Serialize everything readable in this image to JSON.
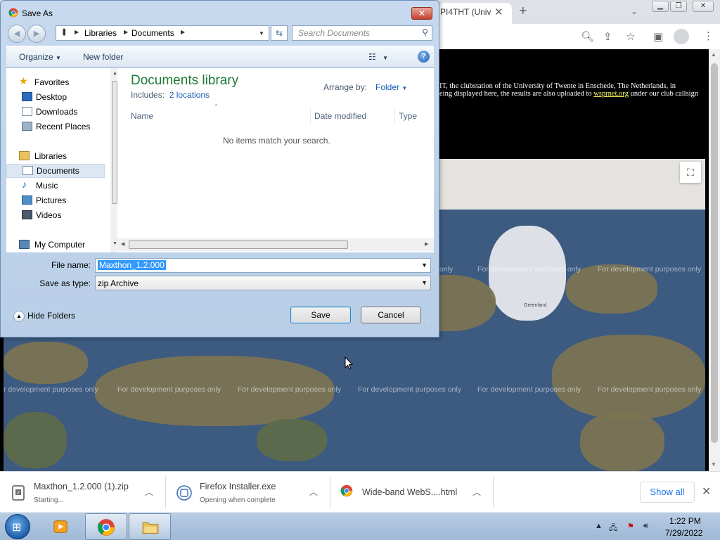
{
  "browser": {
    "tab_title": "PI4THT (Univ",
    "page_text_line1": "IT, the clubstation of the University of Twente in Enschede, The Netherlands, in",
    "page_text_line2_pre": "eing displayed here, the results are also uploaded to ",
    "page_text_link": "wsprnet.org",
    "page_text_line2_post": " under our club callsign",
    "map_watermark": "For development purposes only",
    "map_watermark_partial_left": "r development purposes only",
    "map_watermark_partial_mid": "only",
    "map_label_greenland": "Greenland"
  },
  "dialog": {
    "title": "Save As",
    "address": {
      "segments": [
        "Libraries",
        "Documents"
      ]
    },
    "search_placeholder": "Search Documents",
    "commands": {
      "organize": "Organize",
      "new_folder": "New folder"
    },
    "nav": {
      "favorites": "Favorites",
      "desktop": "Desktop",
      "downloads": "Downloads",
      "recent_places": "Recent Places",
      "libraries": "Libraries",
      "documents": "Documents",
      "music": "Music",
      "pictures": "Pictures",
      "videos": "Videos",
      "my_computer": "My Computer"
    },
    "content": {
      "library_title": "Documents library",
      "includes_label": "Includes:",
      "includes_value": "2 locations",
      "arrange_label": "Arrange by:",
      "arrange_value": "Folder",
      "columns": [
        "Name",
        "Date modified",
        "Type"
      ],
      "empty_message": "No items match your search."
    },
    "file_name_label": "File name:",
    "file_name_value": "Maxthon_1.2.000",
    "save_type_label": "Save as type:",
    "save_type_value": "zip Archive",
    "hide_folders": "Hide Folders",
    "save_button": "Save",
    "cancel_button": "Cancel"
  },
  "downloads": {
    "items": [
      {
        "name": "Maxthon_1.2.000 (1).zip",
        "status": "Starting..."
      },
      {
        "name": "Firefox Installer.exe",
        "status": "Opening when complete"
      },
      {
        "name": "Wide-band WebS....html",
        "status": ""
      }
    ],
    "show_all": "Show all"
  },
  "taskbar": {
    "time": "1:22 PM",
    "date": "7/29/2022"
  }
}
